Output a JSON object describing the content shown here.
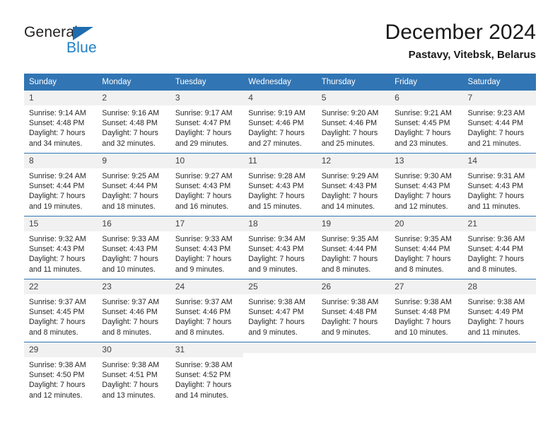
{
  "brand": {
    "name_top": "General",
    "name_bottom": "Blue",
    "color_dark": "#231f20",
    "color_blue": "#1f7fc4",
    "triangle_color": "#1f6cb0"
  },
  "header": {
    "title": "December 2024",
    "subtitle": "Pastavy, Vitebsk, Belarus"
  },
  "theme": {
    "header_blue": "#3175b4",
    "daynum_bg": "#f1f1f1",
    "text": "#262626"
  },
  "calendar": {
    "weekday_headers": [
      "Sunday",
      "Monday",
      "Tuesday",
      "Wednesday",
      "Thursday",
      "Friday",
      "Saturday"
    ],
    "weeks": [
      [
        {
          "day": "1",
          "sunrise": "Sunrise: 9:14 AM",
          "sunset": "Sunset: 4:48 PM",
          "daylight_1": "Daylight: 7 hours",
          "daylight_2": "and 34 minutes."
        },
        {
          "day": "2",
          "sunrise": "Sunrise: 9:16 AM",
          "sunset": "Sunset: 4:48 PM",
          "daylight_1": "Daylight: 7 hours",
          "daylight_2": "and 32 minutes."
        },
        {
          "day": "3",
          "sunrise": "Sunrise: 9:17 AM",
          "sunset": "Sunset: 4:47 PM",
          "daylight_1": "Daylight: 7 hours",
          "daylight_2": "and 29 minutes."
        },
        {
          "day": "4",
          "sunrise": "Sunrise: 9:19 AM",
          "sunset": "Sunset: 4:46 PM",
          "daylight_1": "Daylight: 7 hours",
          "daylight_2": "and 27 minutes."
        },
        {
          "day": "5",
          "sunrise": "Sunrise: 9:20 AM",
          "sunset": "Sunset: 4:46 PM",
          "daylight_1": "Daylight: 7 hours",
          "daylight_2": "and 25 minutes."
        },
        {
          "day": "6",
          "sunrise": "Sunrise: 9:21 AM",
          "sunset": "Sunset: 4:45 PM",
          "daylight_1": "Daylight: 7 hours",
          "daylight_2": "and 23 minutes."
        },
        {
          "day": "7",
          "sunrise": "Sunrise: 9:23 AM",
          "sunset": "Sunset: 4:44 PM",
          "daylight_1": "Daylight: 7 hours",
          "daylight_2": "and 21 minutes."
        }
      ],
      [
        {
          "day": "8",
          "sunrise": "Sunrise: 9:24 AM",
          "sunset": "Sunset: 4:44 PM",
          "daylight_1": "Daylight: 7 hours",
          "daylight_2": "and 19 minutes."
        },
        {
          "day": "9",
          "sunrise": "Sunrise: 9:25 AM",
          "sunset": "Sunset: 4:44 PM",
          "daylight_1": "Daylight: 7 hours",
          "daylight_2": "and 18 minutes."
        },
        {
          "day": "10",
          "sunrise": "Sunrise: 9:27 AM",
          "sunset": "Sunset: 4:43 PM",
          "daylight_1": "Daylight: 7 hours",
          "daylight_2": "and 16 minutes."
        },
        {
          "day": "11",
          "sunrise": "Sunrise: 9:28 AM",
          "sunset": "Sunset: 4:43 PM",
          "daylight_1": "Daylight: 7 hours",
          "daylight_2": "and 15 minutes."
        },
        {
          "day": "12",
          "sunrise": "Sunrise: 9:29 AM",
          "sunset": "Sunset: 4:43 PM",
          "daylight_1": "Daylight: 7 hours",
          "daylight_2": "and 14 minutes."
        },
        {
          "day": "13",
          "sunrise": "Sunrise: 9:30 AM",
          "sunset": "Sunset: 4:43 PM",
          "daylight_1": "Daylight: 7 hours",
          "daylight_2": "and 12 minutes."
        },
        {
          "day": "14",
          "sunrise": "Sunrise: 9:31 AM",
          "sunset": "Sunset: 4:43 PM",
          "daylight_1": "Daylight: 7 hours",
          "daylight_2": "and 11 minutes."
        }
      ],
      [
        {
          "day": "15",
          "sunrise": "Sunrise: 9:32 AM",
          "sunset": "Sunset: 4:43 PM",
          "daylight_1": "Daylight: 7 hours",
          "daylight_2": "and 11 minutes."
        },
        {
          "day": "16",
          "sunrise": "Sunrise: 9:33 AM",
          "sunset": "Sunset: 4:43 PM",
          "daylight_1": "Daylight: 7 hours",
          "daylight_2": "and 10 minutes."
        },
        {
          "day": "17",
          "sunrise": "Sunrise: 9:33 AM",
          "sunset": "Sunset: 4:43 PM",
          "daylight_1": "Daylight: 7 hours",
          "daylight_2": "and 9 minutes."
        },
        {
          "day": "18",
          "sunrise": "Sunrise: 9:34 AM",
          "sunset": "Sunset: 4:43 PM",
          "daylight_1": "Daylight: 7 hours",
          "daylight_2": "and 9 minutes."
        },
        {
          "day": "19",
          "sunrise": "Sunrise: 9:35 AM",
          "sunset": "Sunset: 4:44 PM",
          "daylight_1": "Daylight: 7 hours",
          "daylight_2": "and 8 minutes."
        },
        {
          "day": "20",
          "sunrise": "Sunrise: 9:35 AM",
          "sunset": "Sunset: 4:44 PM",
          "daylight_1": "Daylight: 7 hours",
          "daylight_2": "and 8 minutes."
        },
        {
          "day": "21",
          "sunrise": "Sunrise: 9:36 AM",
          "sunset": "Sunset: 4:44 PM",
          "daylight_1": "Daylight: 7 hours",
          "daylight_2": "and 8 minutes."
        }
      ],
      [
        {
          "day": "22",
          "sunrise": "Sunrise: 9:37 AM",
          "sunset": "Sunset: 4:45 PM",
          "daylight_1": "Daylight: 7 hours",
          "daylight_2": "and 8 minutes."
        },
        {
          "day": "23",
          "sunrise": "Sunrise: 9:37 AM",
          "sunset": "Sunset: 4:46 PM",
          "daylight_1": "Daylight: 7 hours",
          "daylight_2": "and 8 minutes."
        },
        {
          "day": "24",
          "sunrise": "Sunrise: 9:37 AM",
          "sunset": "Sunset: 4:46 PM",
          "daylight_1": "Daylight: 7 hours",
          "daylight_2": "and 8 minutes."
        },
        {
          "day": "25",
          "sunrise": "Sunrise: 9:38 AM",
          "sunset": "Sunset: 4:47 PM",
          "daylight_1": "Daylight: 7 hours",
          "daylight_2": "and 9 minutes."
        },
        {
          "day": "26",
          "sunrise": "Sunrise: 9:38 AM",
          "sunset": "Sunset: 4:48 PM",
          "daylight_1": "Daylight: 7 hours",
          "daylight_2": "and 9 minutes."
        },
        {
          "day": "27",
          "sunrise": "Sunrise: 9:38 AM",
          "sunset": "Sunset: 4:48 PM",
          "daylight_1": "Daylight: 7 hours",
          "daylight_2": "and 10 minutes."
        },
        {
          "day": "28",
          "sunrise": "Sunrise: 9:38 AM",
          "sunset": "Sunset: 4:49 PM",
          "daylight_1": "Daylight: 7 hours",
          "daylight_2": "and 11 minutes."
        }
      ],
      [
        {
          "day": "29",
          "sunrise": "Sunrise: 9:38 AM",
          "sunset": "Sunset: 4:50 PM",
          "daylight_1": "Daylight: 7 hours",
          "daylight_2": "and 12 minutes."
        },
        {
          "day": "30",
          "sunrise": "Sunrise: 9:38 AM",
          "sunset": "Sunset: 4:51 PM",
          "daylight_1": "Daylight: 7 hours",
          "daylight_2": "and 13 minutes."
        },
        {
          "day": "31",
          "sunrise": "Sunrise: 9:38 AM",
          "sunset": "Sunset: 4:52 PM",
          "daylight_1": "Daylight: 7 hours",
          "daylight_2": "and 14 minutes."
        },
        {
          "day": "",
          "sunrise": "",
          "sunset": "",
          "daylight_1": "",
          "daylight_2": ""
        },
        {
          "day": "",
          "sunrise": "",
          "sunset": "",
          "daylight_1": "",
          "daylight_2": ""
        },
        {
          "day": "",
          "sunrise": "",
          "sunset": "",
          "daylight_1": "",
          "daylight_2": ""
        },
        {
          "day": "",
          "sunrise": "",
          "sunset": "",
          "daylight_1": "",
          "daylight_2": ""
        }
      ]
    ]
  }
}
